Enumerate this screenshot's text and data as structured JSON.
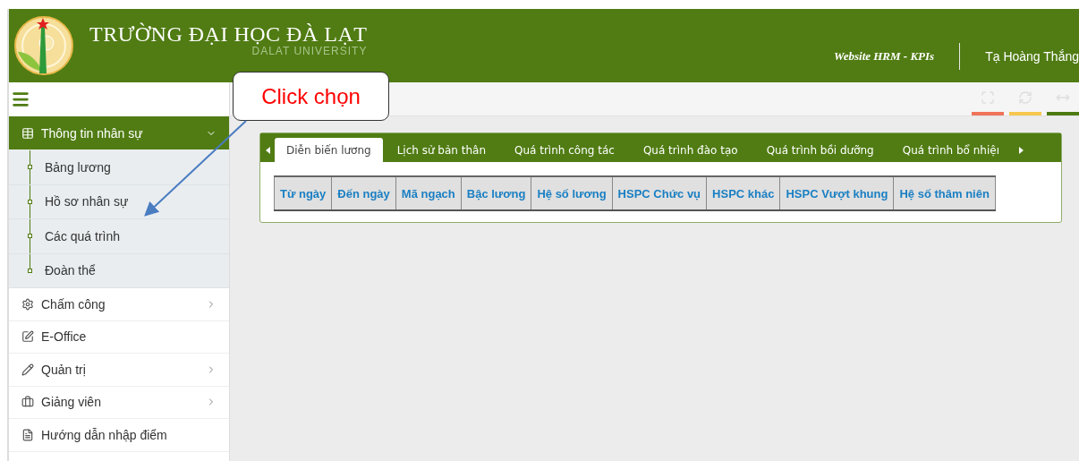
{
  "header": {
    "title": "TRƯỜNG ĐẠI HỌC ĐÀ LẠT",
    "subtitle": "DALAT UNIVERSITY",
    "site_name": "Website HRM - KPIs",
    "user": "Tạ Hoàng Thắng"
  },
  "toolbar": {
    "tools": [
      {
        "kind": "expand",
        "color": "#f0735a"
      },
      {
        "kind": "refresh",
        "color": "#f5c74e"
      },
      {
        "kind": "resize",
        "color": "#4e7a12"
      }
    ]
  },
  "sidebar": {
    "items": [
      {
        "label": "Thông tin nhân sự",
        "kind": "table",
        "expanded": true,
        "has_submenu": true,
        "children": [
          {
            "label": "Bảng lương"
          },
          {
            "label": "Hồ sơ nhân sự"
          },
          {
            "label": "Các quá trình"
          },
          {
            "label": "Đoàn thể"
          }
        ]
      },
      {
        "label": "Chấm công",
        "kind": "gear",
        "expanded": false,
        "has_submenu": true
      },
      {
        "label": "E-Office",
        "kind": "check",
        "expanded": false,
        "has_submenu": false
      },
      {
        "label": "Quản trị",
        "kind": "pencil",
        "expanded": false,
        "has_submenu": true
      },
      {
        "label": "Giảng viên",
        "kind": "briefcase",
        "expanded": false,
        "has_submenu": true
      },
      {
        "label": "Hướng dẫn nhập điểm",
        "kind": "file",
        "expanded": false,
        "has_submenu": false
      }
    ]
  },
  "tabs": [
    {
      "label": "Diễn biến lương",
      "selected": true
    },
    {
      "label": "Lịch sử bản thân",
      "selected": false
    },
    {
      "label": "Quá trình công tác",
      "selected": false
    },
    {
      "label": "Quá trình đào tạo",
      "selected": false
    },
    {
      "label": "Quá trình bồi dưỡng",
      "selected": false
    },
    {
      "label": "Quá trình bổ nhiệı",
      "selected": false
    }
  ],
  "table": {
    "columns": [
      "Từ ngày",
      "Đến ngày",
      "Mã ngạch",
      "Bậc lương",
      "Hệ số lương",
      "HSPC Chức vụ",
      "HSPC khác",
      "HSPC Vượt khung",
      "Hệ số thâm niên"
    ]
  },
  "callout": {
    "text": "Click chọn"
  }
}
